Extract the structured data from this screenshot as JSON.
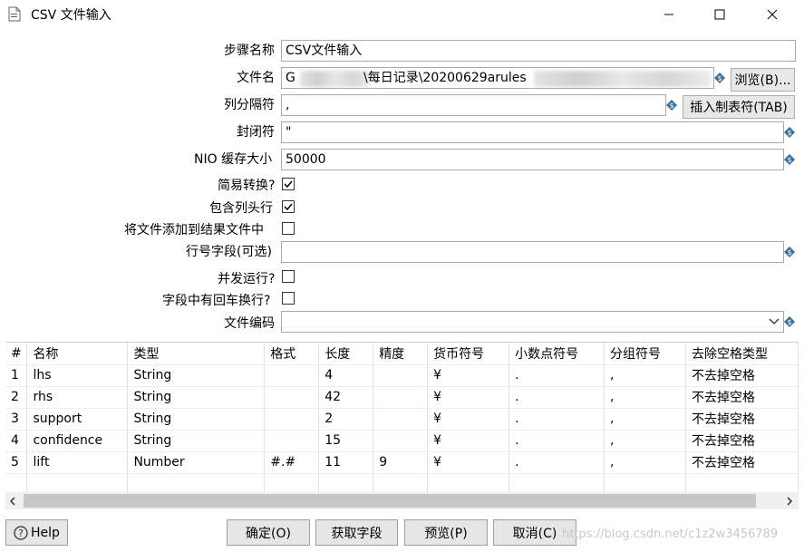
{
  "window": {
    "title": "CSV 文件输入"
  },
  "form": {
    "step_name_label": "步骤名称",
    "step_name_value": "CSV文件输入",
    "filename_label": "文件名",
    "filename_prefix": "G",
    "filename_middle": "\\每日记录\\20200629arules",
    "browse_label": "浏览(B)...",
    "delimiter_label": "列分隔符",
    "delimiter_value": ",",
    "insert_tab_label": "插入制表符(TAB)",
    "enclosure_label": "封闭符",
    "enclosure_value": "\"",
    "nio_label": "NIO 缓存大小",
    "nio_value": "50000",
    "lazy_label": "简易转换?",
    "header_label": "包含列头行",
    "add_result_label": "将文件添加到结果文件中",
    "rownum_label": "行号字段(可选)",
    "parallel_label": "并发运行?",
    "newline_label": "字段中有回车换行?",
    "encoding_label": "文件编码"
  },
  "table": {
    "columns": [
      "#",
      "名称",
      "类型",
      "格式",
      "长度",
      "精度",
      "货币符号",
      "小数点符号",
      "分组符号",
      "去除空格类型"
    ],
    "rows": [
      [
        "1",
        "lhs",
        "String",
        "",
        "4",
        "",
        "¥",
        ".",
        ",",
        "不去掉空格"
      ],
      [
        "2",
        "rhs",
        "String",
        "",
        "42",
        "",
        "¥",
        ".",
        ",",
        "不去掉空格"
      ],
      [
        "3",
        "support",
        "String",
        "",
        "2",
        "",
        "¥",
        ".",
        ",",
        "不去掉空格"
      ],
      [
        "4",
        "confidence",
        "String",
        "",
        "15",
        "",
        "¥",
        ".",
        ",",
        "不去掉空格"
      ],
      [
        "5",
        "lift",
        "Number",
        "#.#",
        "11",
        "9",
        "¥",
        ".",
        ",",
        "不去掉空格"
      ]
    ]
  },
  "buttons": {
    "help": "Help",
    "ok": "确定(O)",
    "get_fields": "获取字段",
    "preview": "预览(P)",
    "cancel": "取消(C)"
  },
  "watermark": "https://blog.csdn.net/c1z2w3456789"
}
